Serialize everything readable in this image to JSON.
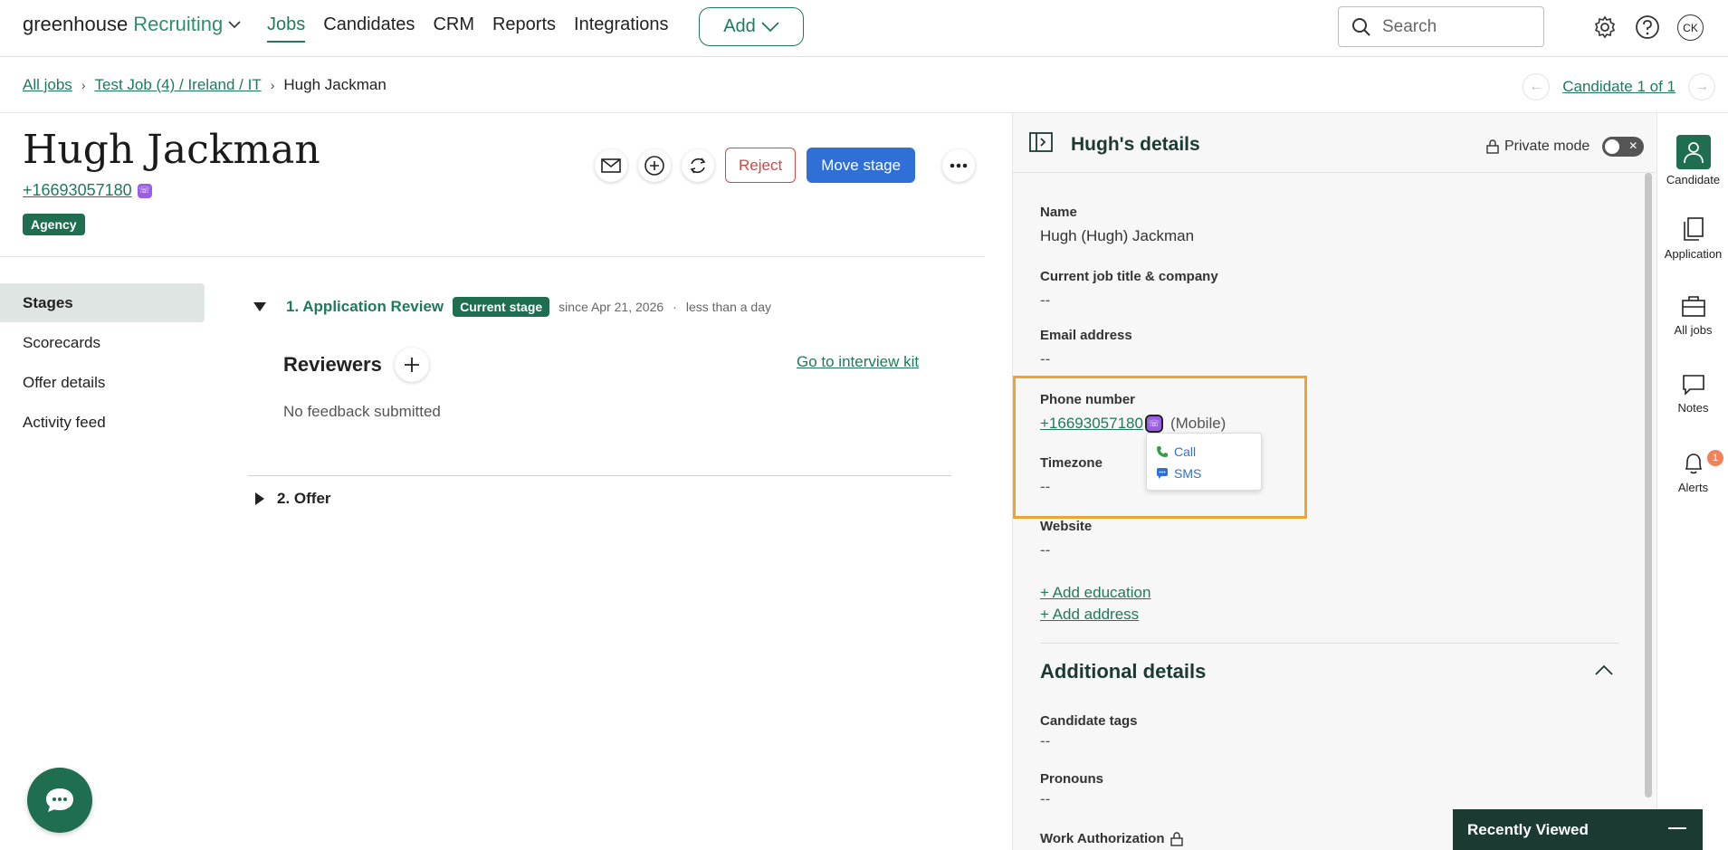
{
  "app": {
    "logo_text": "greenhouse",
    "logo_product": "Recruiting",
    "nav": [
      "Jobs",
      "Candidates",
      "CRM",
      "Reports",
      "Integrations"
    ],
    "add_label": "Add",
    "search_placeholder": "Search",
    "avatar_initials": "CK"
  },
  "breadcrumb": {
    "all_jobs": "All jobs",
    "job": "Test Job (4) / Ireland / IT",
    "current": "Hugh Jackman",
    "candidate_position": "Candidate 1 of 1"
  },
  "candidate": {
    "name": "Hugh Jackman",
    "phone": "+16693057180",
    "tag": "Agency"
  },
  "actions": {
    "reject": "Reject",
    "move_stage": "Move stage"
  },
  "left_nav": [
    "Stages",
    "Scorecards",
    "Offer details",
    "Activity feed"
  ],
  "stages": {
    "stage1_title": "1. Application Review",
    "current_badge": "Current stage",
    "since": "since Apr 21, 2026",
    "duration": "less than a day",
    "reviewers_label": "Reviewers",
    "interview_kit": "Go to interview kit",
    "no_feedback": "No feedback submitted",
    "stage2_title": "2. Offer"
  },
  "details": {
    "title": "Hugh's details",
    "private_mode": "Private mode",
    "name_label": "Name",
    "name_value": "Hugh (Hugh) Jackman",
    "job_label": "Current job title & company",
    "job_value": "--",
    "email_label": "Email address",
    "email_value": "--",
    "phone_label": "Phone number",
    "phone_value": "+16693057180",
    "phone_type": "(Mobile)",
    "timezone_label": "Timezone",
    "timezone_value": "--",
    "website_label": "Website",
    "website_value": "--",
    "add_education": "+ Add education",
    "add_address": "+ Add address",
    "additional_title": "Additional details",
    "tags_label": "Candidate tags",
    "tags_value": "--",
    "pronouns_label": "Pronouns",
    "pronouns_value": "--",
    "work_auth_label": "Work Authorization",
    "popup": {
      "call": "Call",
      "sms": "SMS"
    }
  },
  "rail": {
    "candidate": "Candidate",
    "application": "Application",
    "all_jobs": "All jobs",
    "notes": "Notes",
    "alerts": "Alerts",
    "alerts_count": "1"
  },
  "recently_viewed": "Recently Viewed",
  "colors": {
    "brand_green": "#1f6e4f",
    "link_green": "#1f7a5c",
    "primary_blue": "#2f6fd6",
    "reject_red": "#d64541",
    "highlight_orange": "#f0a430"
  }
}
